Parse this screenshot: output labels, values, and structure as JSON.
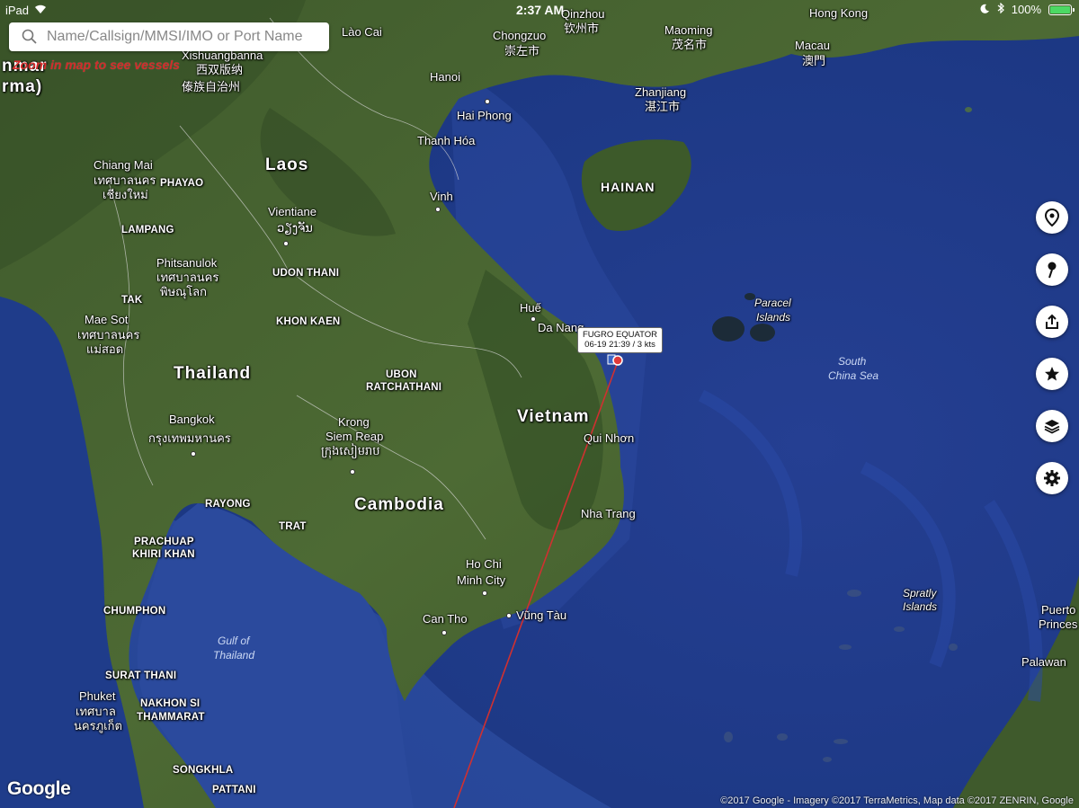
{
  "status_bar": {
    "device": "iPad",
    "time": "2:37 AM",
    "battery": "100%",
    "battery_level": 1.0
  },
  "search": {
    "placeholder": "Name/Callsign/MMSI/IMO or Port Name"
  },
  "zoom_hint": "Zoom in map to see vessels",
  "vessel": {
    "name": "FUGRO EQUATOR",
    "detail": "06-19 21:39 / 3 kts",
    "track_color": "#d03030"
  },
  "side_buttons": [
    {
      "icon": "location-pin-icon"
    },
    {
      "icon": "map-pin-icon"
    },
    {
      "icon": "share-icon"
    },
    {
      "icon": "star-icon"
    },
    {
      "icon": "layers-icon"
    },
    {
      "icon": "gear-icon"
    }
  ],
  "map": {
    "countries": {
      "laos": "Laos",
      "thailand": "Thailand",
      "cambodia": "Cambodia",
      "vietnam": "Vietnam",
      "myanmar_1": "nmar",
      "myanmar_2": "rma)",
      "hainan": "HAINAN"
    },
    "cities": {
      "lao_cai": "Lào Cai",
      "xishuangbanna_en": "Xishuangbanna",
      "xishuangbanna_zh1": "西双版纳",
      "xishuangbanna_zh2": "傣族自治州",
      "chongzuo_en": "Chongzuo",
      "chongzuo_zh": "崇左市",
      "qinzhou_en": "Qinzhou",
      "qinzhou_zh": "钦州市",
      "maoming_en": "Maoming",
      "maoming_zh": "茂名市",
      "hongkong": "Hong Kong",
      "macau_en": "Macau",
      "macau_zh": "澳門",
      "zhanjiang_en": "Zhanjiang",
      "zhanjiang_zh": "湛江市",
      "hanoi": "Hanoi",
      "haiphong": "Hai Phong",
      "thanhhoa": "Thanh Hóa",
      "vinh": "Vinh",
      "chiangmai_en": "Chiang Mai",
      "chiangmai_th": "เทศบาลนคร",
      "chiangmai_th2": "เชียงใหม่",
      "phayao": "PHAYAO",
      "lampang": "LAMPANG",
      "vientiane_en": "Vientiane",
      "vientiane_lo": "ວຽງຈັນ",
      "phitsanulok_en": "Phitsanulok",
      "phitsanulok_th": "เทศบาลนคร",
      "phitsanulok_th2": "พิษณุโลก",
      "udonthani": "UDON THANI",
      "tak": "TAK",
      "khonkaen": "KHON KAEN",
      "maesot_en": "Mae Sot",
      "maesot_th": "เทศบาลนคร",
      "maesot_th2": "แม่สอด",
      "hue": "Huế",
      "danang": "Da Nang",
      "ubon_1": "UBON",
      "ubon_2": "RATCHATHANI",
      "bangkok_en": "Bangkok",
      "bangkok_th": "กรุงเทพมหานคร",
      "krongsiemreap_1": "Krong",
      "krongsiemreap_2": "Siem Reap",
      "krongsiemreap_km": "ក្រុងសៀមរាប",
      "quinhon": "Qui Nhơn",
      "rayong": "RAYONG",
      "trat": "TRAT",
      "nhatrang": "Nha Trang",
      "prachuap_1": "PRACHUAP",
      "prachuap_2": "KHIRI KHAN",
      "hcmc_1": "Ho Chi",
      "hcmc_2": "Minh City",
      "chumphon": "CHUMPHON",
      "vungtau": "Vũng Tàu",
      "cantho": "Can Tho",
      "suratthani": "SURAT THANI",
      "phuket_en": "Phuket",
      "phuket_th": "เทศบาล",
      "phuket_th2": "นครภูเก็ต",
      "nakhon_1": "NAKHON SI",
      "nakhon_2": "THAMMARAT",
      "songkhla": "SONGKHLA",
      "pattani": "PATTANI",
      "puerto_1": "Puerto",
      "puerto_2": "Princes",
      "palawan": "Palawan"
    },
    "seas": {
      "gulf_1": "Gulf of",
      "gulf_2": "Thailand",
      "scs_1": "South",
      "scs_2": "China Sea",
      "paracel_1": "Paracel",
      "paracel_2": "Islands",
      "spratly_1": "Spratly",
      "spratly_2": "Islands"
    }
  },
  "footer": {
    "google": "Google",
    "copyright": "©2017 Google - Imagery ©2017 TerraMetrics, Map data ©2017 ZENRIN, Google"
  }
}
